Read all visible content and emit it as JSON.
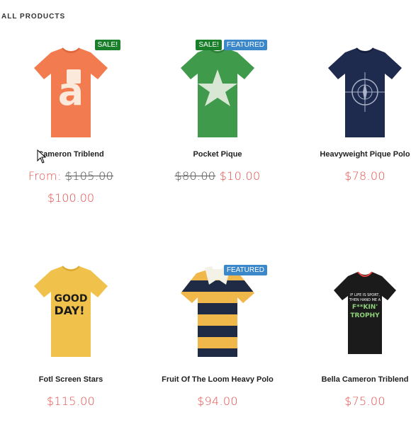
{
  "section": {
    "title": "ALL PRODUCTS"
  },
  "products": [
    {
      "name": "Cameron Triblend",
      "badges": {
        "sale": "SALE!"
      },
      "price_prefix": "From:",
      "old_price": "$105.00",
      "price": "$100.00",
      "image_icon": "orange-tshirt-letter-a",
      "color": "#f27c4f"
    },
    {
      "name": "Pocket Pique",
      "badges": {
        "sale": "SALE!",
        "featured": "FEATURED"
      },
      "old_price": "$80.00",
      "price": "$10.00",
      "image_icon": "green-tshirt-star",
      "color": "#3f9a4b"
    },
    {
      "name": "Heavyweight Pique Polo",
      "price": "$78.00",
      "image_icon": "navy-tshirt-compass",
      "color": "#1f2a4f"
    },
    {
      "name": "Fotl Screen Stars",
      "price": "$115.00",
      "image_icon": "yellow-tshirt-good-day",
      "color": "#f1c24b",
      "shirt_text": "GOOD DAY!"
    },
    {
      "name": "Fruit Of The Loom Heavy Polo",
      "badges": {
        "featured": "FEATURED"
      },
      "price": "$94.00",
      "image_icon": "striped-rugby-polo",
      "color": "#f0b84a"
    },
    {
      "name": "Bella Cameron Triblend",
      "price": "$75.00",
      "image_icon": "black-tshirt-trophy",
      "color": "#1b1b1b",
      "shirt_text": "IF LIFE IS SPORT, THEN HAND ME A F**KIN' TROPHY"
    }
  ]
}
